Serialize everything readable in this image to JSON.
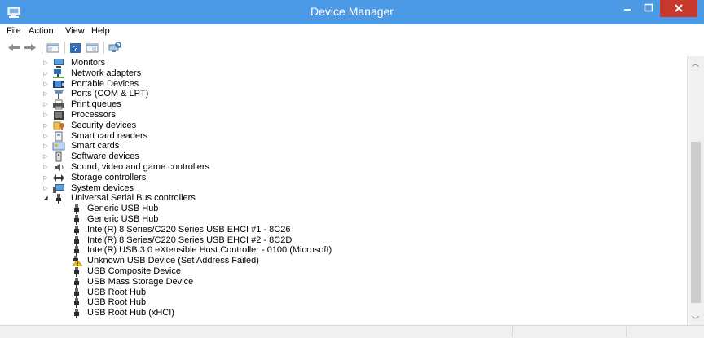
{
  "window": {
    "title": "Device Manager",
    "accent_color": "#4c9ae6",
    "close_color": "#c7392d"
  },
  "menu": [
    {
      "label": "File"
    },
    {
      "label": "Action"
    },
    {
      "label": "View"
    },
    {
      "label": "Help"
    }
  ],
  "toolbar": {
    "back_icon": "back-arrow-icon",
    "forward_icon": "forward-arrow-icon",
    "tool_icons": [
      "show-hide-console-tree-icon",
      "help-icon",
      "properties-icon",
      "scan-hardware-icon"
    ]
  },
  "tree": {
    "categories": [
      {
        "label": "Monitors",
        "icon": "monitor-icon",
        "expanded": false
      },
      {
        "label": "Network adapters",
        "icon": "network-adapter-icon",
        "expanded": false
      },
      {
        "label": "Portable Devices",
        "icon": "portable-device-icon",
        "expanded": false
      },
      {
        "label": "Ports (COM & LPT)",
        "icon": "port-icon",
        "expanded": false
      },
      {
        "label": "Print queues",
        "icon": "printer-icon",
        "expanded": false
      },
      {
        "label": "Processors",
        "icon": "processor-icon",
        "expanded": false
      },
      {
        "label": "Security devices",
        "icon": "security-device-icon",
        "expanded": false
      },
      {
        "label": "Smart card readers",
        "icon": "smart-card-reader-icon",
        "expanded": false
      },
      {
        "label": "Smart cards",
        "icon": "smart-card-icon",
        "expanded": false
      },
      {
        "label": "Software devices",
        "icon": "software-device-icon",
        "expanded": false
      },
      {
        "label": "Sound, video and game controllers",
        "icon": "speaker-icon",
        "expanded": false
      },
      {
        "label": "Storage controllers",
        "icon": "storage-controller-icon",
        "expanded": false
      },
      {
        "label": "System devices",
        "icon": "system-device-icon",
        "expanded": false
      },
      {
        "label": "Universal Serial Bus controllers",
        "icon": "usb-icon",
        "expanded": true
      }
    ],
    "usb_children": [
      {
        "label": "Generic USB Hub",
        "icon": "usb-device-icon",
        "warning": false
      },
      {
        "label": "Generic USB Hub",
        "icon": "usb-device-icon",
        "warning": false
      },
      {
        "label": "Intel(R) 8 Series/C220 Series USB EHCI #1 - 8C26",
        "icon": "usb-device-icon",
        "warning": false
      },
      {
        "label": "Intel(R) 8 Series/C220 Series USB EHCI #2 - 8C2D",
        "icon": "usb-device-icon",
        "warning": false
      },
      {
        "label": "Intel(R) USB 3.0 eXtensible Host Controller - 0100 (Microsoft)",
        "icon": "usb-device-icon",
        "warning": false
      },
      {
        "label": "Unknown USB Device (Set Address Failed)",
        "icon": "warning-usb-device-icon",
        "warning": true
      },
      {
        "label": "USB Composite Device",
        "icon": "usb-device-icon",
        "warning": false
      },
      {
        "label": "USB Mass Storage Device",
        "icon": "usb-device-icon",
        "warning": false
      },
      {
        "label": "USB Root Hub",
        "icon": "usb-device-icon",
        "warning": false
      },
      {
        "label": "USB Root Hub",
        "icon": "usb-device-icon",
        "warning": false
      },
      {
        "label": "USB Root Hub (xHCI)",
        "icon": "usb-device-icon",
        "warning": false
      }
    ]
  }
}
